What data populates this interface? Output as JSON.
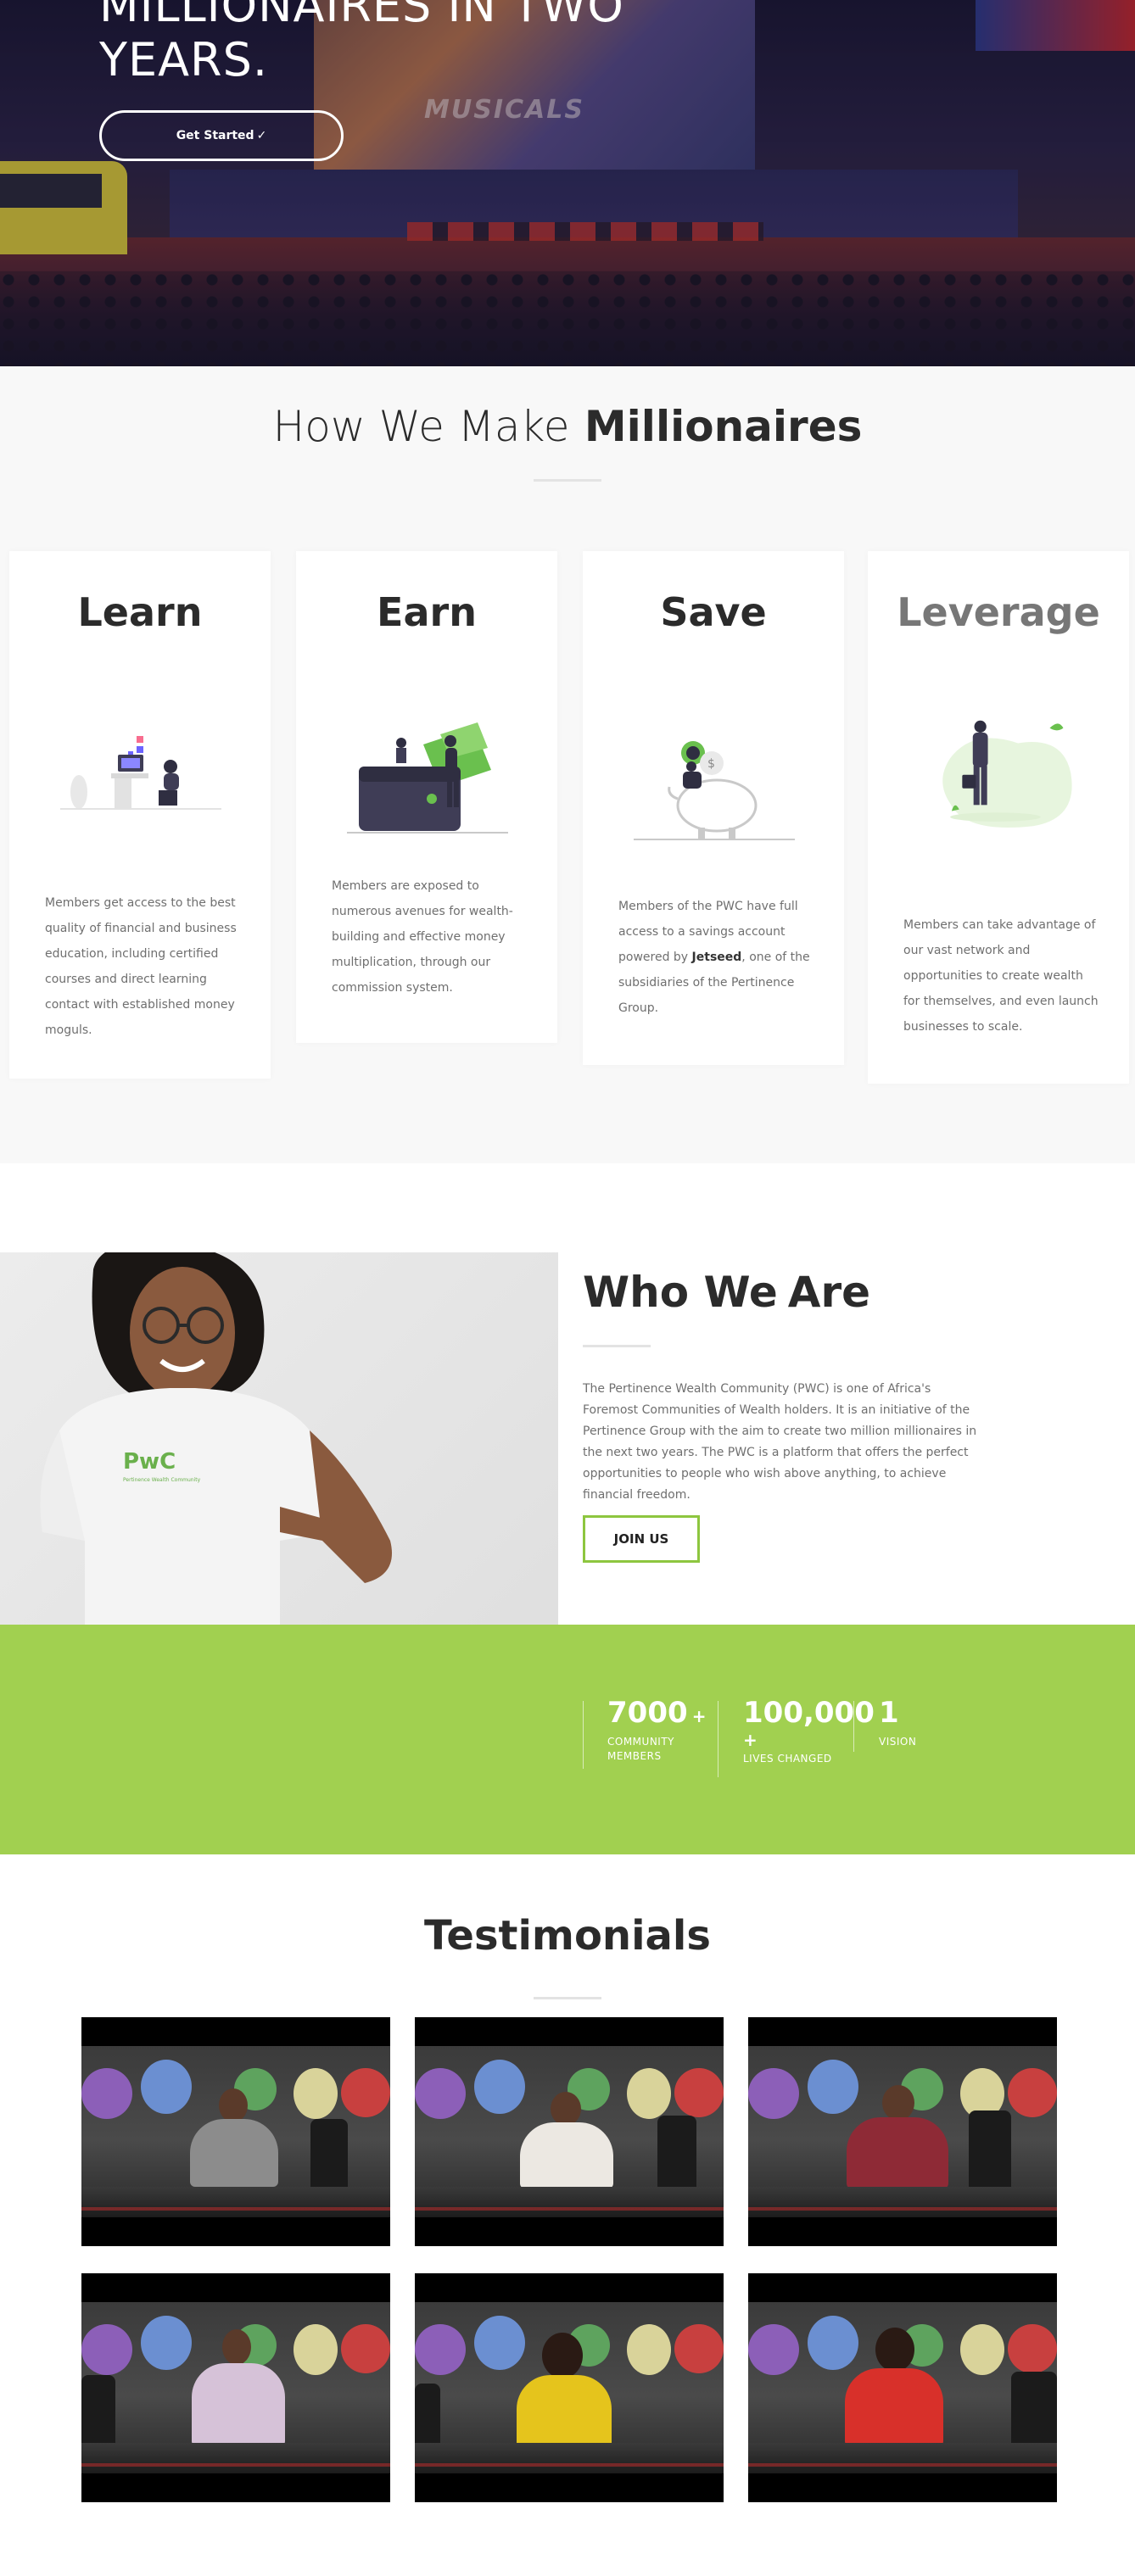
{
  "hero": {
    "title_line1": "MILLIONAIRES IN TWO",
    "title_line2": "YEARS.",
    "screen_word": "MUSICALS",
    "cta_label": "Get Started",
    "cta_icon": "check-icon"
  },
  "how": {
    "title_light": "How We Make",
    "title_bold": "Millionaires",
    "cards": [
      {
        "title": "Learn",
        "illustration": "online-learning-illustration",
        "text": "Members get access to the best quality of financial and business education, including certified courses and direct learning contact with established money moguls."
      },
      {
        "title": "Earn",
        "illustration": "wallet-earning-illustration",
        "text": "Members are exposed to numerous avenues for wealth-building and effective money multiplication, through our commission system."
      },
      {
        "title": "Save",
        "illustration": "piggy-bank-saving-illustration",
        "text_before": "Members of the PWC have full access to a savings account powered by ",
        "text_bold": "Jetseed",
        "text_after": ", one of the subsidiaries of the Pertinence Group."
      },
      {
        "title": "Leverage",
        "illustration": "businessman-phone-illustration",
        "text": "Members can take advantage of our vast network and opportunities to create wealth for themselves, and even launch businesses to scale."
      }
    ]
  },
  "who": {
    "title_light": "Who We",
    "title_bold": "Are",
    "text": "The Pertinence Wealth Community (PWC) is one of Africa's Foremost Communities of Wealth holders. It is an initiative of the Pertinence Group with the aim to create two million millionaires in the next two years. The PWC is a platform that offers the perfect opportunities to people who wish above anything, to achieve financial freedom.",
    "button_label": "JOIN US",
    "shirt_logo": "PwC",
    "shirt_sub": "Pertinence Wealth Community"
  },
  "stats": [
    {
      "num": "7000",
      "suffix": "+",
      "label_line1": "COMMUNITY",
      "label_line2": "MEMBERS"
    },
    {
      "num": "100,000",
      "suffix": "+",
      "label_line1": "LIVES CHANGED",
      "label_line2": ""
    },
    {
      "num": "1",
      "suffix": "",
      "label_line1": "VISION",
      "label_line2": ""
    }
  ],
  "testimonials": {
    "title": "Testimonials",
    "videos": [
      {
        "name": "testimonial-video-1"
      },
      {
        "name": "testimonial-video-2"
      },
      {
        "name": "testimonial-video-3"
      },
      {
        "name": "testimonial-video-4"
      },
      {
        "name": "testimonial-video-5"
      },
      {
        "name": "testimonial-video-6"
      }
    ]
  },
  "colors": {
    "accent_green": "#a1d050",
    "button_border_green": "#8dc63f",
    "heading_dark": "#2b2b2b",
    "body_text": "#6f6f6f",
    "section_bg": "#f8f8f8"
  }
}
